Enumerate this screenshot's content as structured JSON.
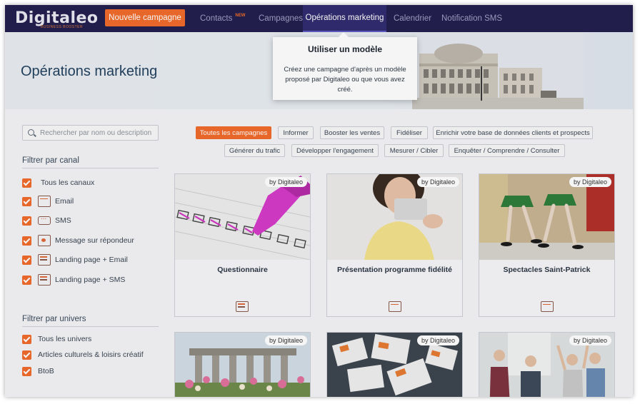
{
  "nav": {
    "logo": "Digitaleo",
    "logo_tagline": "BUSINESS BOOSTER",
    "new_campaign": "Nouvelle campagne",
    "items": [
      {
        "label": "Contacts",
        "badge": "NEW"
      },
      {
        "label": "Campagnes"
      },
      {
        "label": "Opérations marketing",
        "active": true
      },
      {
        "label": "Calendrier"
      },
      {
        "label": "Notification SMS"
      }
    ]
  },
  "hero": {
    "title": "Opérations marketing"
  },
  "popup": {
    "title": "Utiliser un modèle",
    "text": "Créez une campagne d'après un modèle proposé par Digitaleo ou que vous avez créé."
  },
  "search": {
    "placeholder": "Rechercher par nom ou description"
  },
  "filters": {
    "channel_title": "Filtrer par canal",
    "channels": [
      {
        "label": "Tous les canaux",
        "icon": null
      },
      {
        "label": "Email",
        "icon": "email-icon"
      },
      {
        "label": "SMS",
        "icon": "sms-icon"
      },
      {
        "label": "Message sur répondeur",
        "icon": "voicemail-icon"
      },
      {
        "label": "Landing page + Email",
        "icon": "landing-email-icon"
      },
      {
        "label": "Landing page + SMS",
        "icon": "landing-sms-icon"
      }
    ],
    "universe_title": "Filtrer par univers",
    "universes": [
      {
        "label": "Tous les univers"
      },
      {
        "label": "Articles culturels & loisirs créatif"
      },
      {
        "label": "BtoB"
      }
    ]
  },
  "chips": [
    {
      "label": "Toutes les campagnes",
      "active": true
    },
    {
      "label": "Informer"
    },
    {
      "label": "Booster les ventes"
    },
    {
      "label": "Fidéliser"
    },
    {
      "label": "Enrichir votre base de données clients et prospects"
    },
    {
      "label": "Générer du trafic"
    },
    {
      "label": "Développer l'engagement"
    },
    {
      "label": "Mesurer / Cibler"
    },
    {
      "label": "Enquêter / Comprendre / Consulter"
    }
  ],
  "cards": [
    {
      "badge": "by Digitaleo",
      "title": "Questionnaire",
      "icon": "landing-email-icon"
    },
    {
      "badge": "by Digitaleo",
      "title": "Présentation programme fidélité",
      "icon": "email-icon"
    },
    {
      "badge": "by Digitaleo",
      "title": "Spectacles Saint-Patrick",
      "icon": "email-icon"
    },
    {
      "badge": "by Digitaleo",
      "title": ""
    },
    {
      "badge": "by Digitaleo",
      "title": ""
    },
    {
      "badge": "by Digitaleo",
      "title": ""
    }
  ],
  "colors": {
    "nav_bg": "#232050",
    "accent": "#f06c2b",
    "active_tab": "#302c70"
  }
}
